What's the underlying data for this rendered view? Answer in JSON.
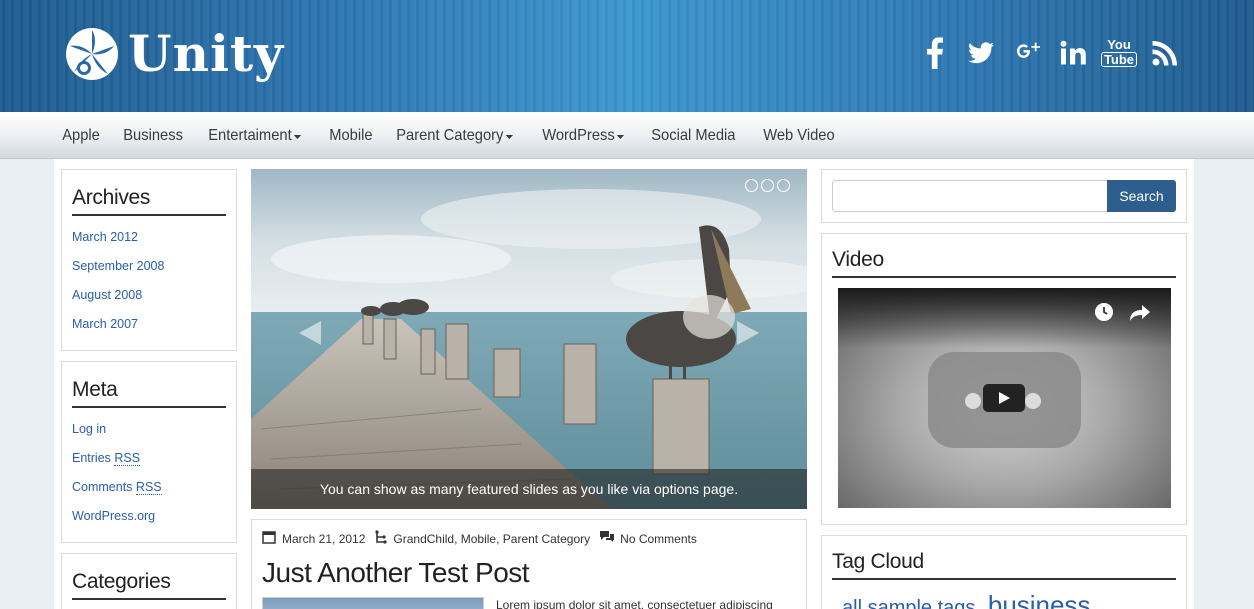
{
  "site": {
    "name": "Unity"
  },
  "social": [
    "facebook-icon",
    "twitter-icon",
    "google-plus-icon",
    "linkedin-icon",
    "youtube-icon",
    "rss-icon"
  ],
  "social_youtube": {
    "line1": "You",
    "line2": "Tube"
  },
  "nav": [
    {
      "label": "Apple",
      "dropdown": false
    },
    {
      "label": "Business",
      "dropdown": false
    },
    {
      "label": "Entertaiment",
      "dropdown": true
    },
    {
      "label": "Mobile",
      "dropdown": false
    },
    {
      "label": "Parent Category",
      "dropdown": true
    },
    {
      "label": "WordPress",
      "dropdown": true
    },
    {
      "label": "Social Media",
      "dropdown": false
    },
    {
      "label": "Web Video",
      "dropdown": false
    }
  ],
  "archives": {
    "title": "Archives",
    "items": [
      "March 2012",
      "September 2008",
      "August 2008",
      "March 2007"
    ]
  },
  "meta": {
    "title": "Meta",
    "items": [
      "Log in",
      "Entries",
      "Comments",
      "WordPress.org"
    ],
    "rss": "RSS"
  },
  "categories": {
    "title": "Categories"
  },
  "slider": {
    "caption": "You can show as many featured slides as you like via options page.",
    "slide_count": 3
  },
  "post": {
    "date": "March 21, 2012",
    "categories": "GrandChild, Mobile, Parent Category",
    "comments": "No Comments",
    "title": "Just Another Test Post",
    "excerpt": "Lorem ipsum dolor sit amet, consectetuer adipiscing"
  },
  "search": {
    "button": "Search",
    "placeholder": ""
  },
  "video_widget": {
    "title": "Video"
  },
  "tag_cloud": {
    "title": "Tag Cloud",
    "tags": [
      "all sample tags",
      "business"
    ]
  },
  "colors": {
    "header_dark": "#1d5a8e",
    "header_light": "#3b95cf",
    "link": "#2a5ea8",
    "search_button": "#2d5e8d"
  }
}
